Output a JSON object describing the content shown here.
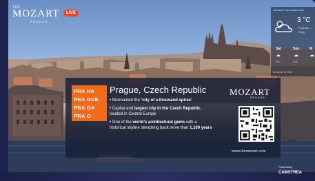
{
  "logo": {
    "the": "THE",
    "name": "MOZART",
    "sub": "PRAGUE"
  },
  "live_badge": "LIVE",
  "weather": {
    "header": "Live from The Mozart Hote",
    "temperature": "3 °C",
    "feels": "Feels like 1°",
    "detail": "Partly",
    "days": [
      {
        "label": "Sat",
        "icon": "☁",
        "temps": "7°/2°"
      },
      {
        "label": "Sun",
        "icon": "☁",
        "temps": "6°/1°"
      },
      {
        "label": "M",
        "icon": "☁",
        "temps": ""
      }
    ],
    "footer": "December 14, 2024"
  },
  "card": {
    "tiles": [
      "PRA HA",
      "PRA GUE",
      "PRA GA",
      "PRA G"
    ],
    "title": "Prague, Czech Republic",
    "bullets": [
      {
        "pre": "Nicknamed the “",
        "bold": "city of a thousand spires",
        "post": "”"
      },
      {
        "pre": "Capital and ",
        "bold": "largest city in the Czech Republic",
        "post": ", located in Central Europe"
      },
      {
        "pre": "One of the ",
        "bold": "world’s architectural gems",
        "post": " with a historical skyline stretching back more than ",
        "bold2": "1,100 years"
      }
    ],
    "brand": "MOZART",
    "brand_sub": "PRAGUE",
    "url": "www.themozart.com"
  },
  "powered": {
    "label": "Powered by",
    "brand": "CAMSTREA"
  },
  "colors": {
    "accent": "#f26a1b",
    "live": "#e8452d",
    "card_bg": "#161e34"
  }
}
